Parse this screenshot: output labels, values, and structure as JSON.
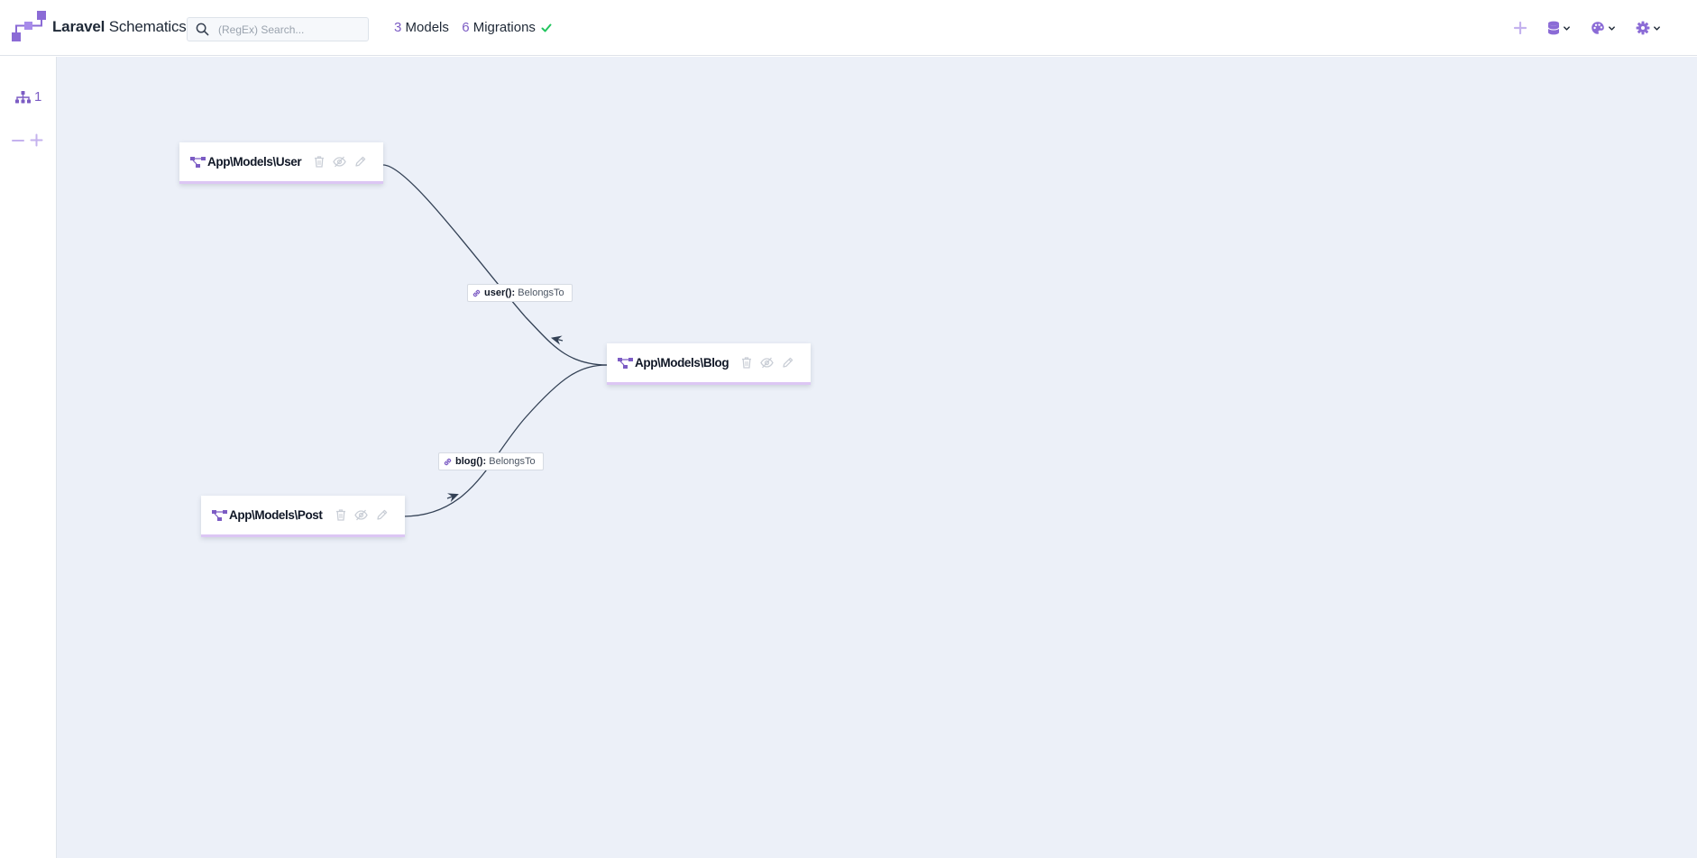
{
  "app": {
    "brand_bold": "Laravel",
    "brand_rest": "Schematics"
  },
  "search": {
    "placeholder": "(RegEx) Search..."
  },
  "stats": {
    "models_count": "3",
    "models_label": "Models",
    "migrations_count": "6",
    "migrations_label": "Migrations"
  },
  "toolbar": {
    "icons": [
      "plus-icon",
      "database-icon",
      "palette-icon",
      "gear-icon"
    ]
  },
  "sidebar": {
    "tree_count": "1"
  },
  "nodes": [
    {
      "title": "App\\Models\\User"
    },
    {
      "title": "App\\Models\\Blog"
    },
    {
      "title": "App\\Models\\Post"
    }
  ],
  "edges": [
    {
      "method": "user():",
      "type": "BelongsTo"
    },
    {
      "method": "blog():",
      "type": "BelongsTo"
    }
  ],
  "colors": {
    "accent": "#7c5cc4",
    "canvas": "#ecf0f8",
    "success": "#22c55e",
    "edge": "#334155"
  }
}
